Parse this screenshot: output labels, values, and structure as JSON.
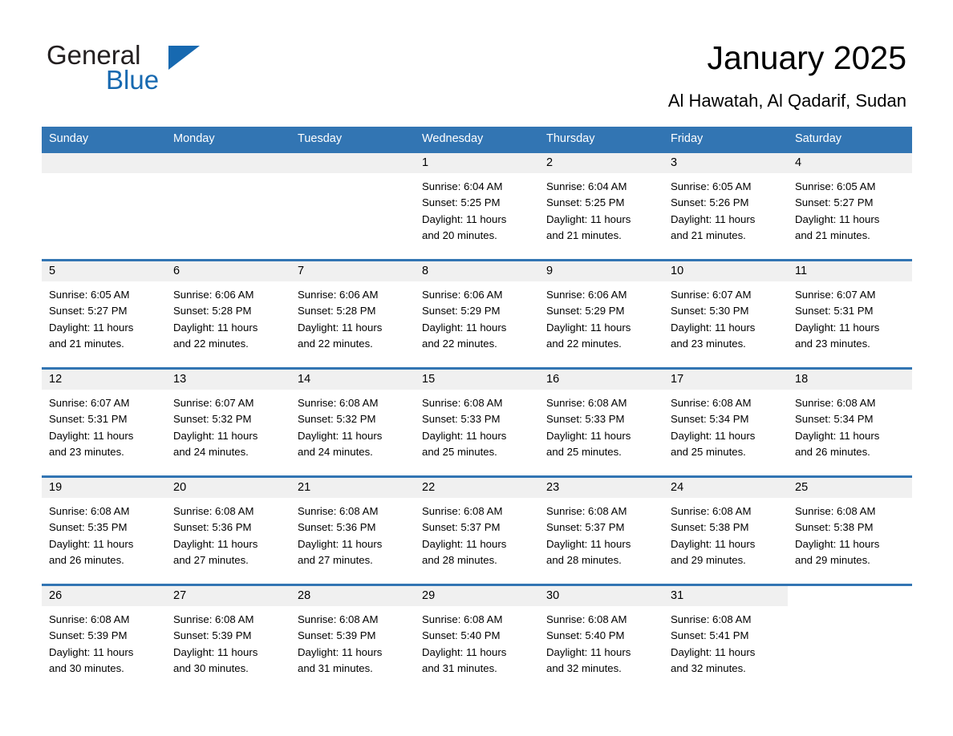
{
  "brand": {
    "name_part1": "General",
    "name_part2": "Blue",
    "accent_color": "#1769b0"
  },
  "header": {
    "title": "January 2025",
    "subtitle": "Al Hawatah, Al Qadarif, Sudan"
  },
  "calendar": {
    "header_bg": "#3275b3",
    "daynum_bg": "#f0f0f0",
    "weekday_names": [
      "Sunday",
      "Monday",
      "Tuesday",
      "Wednesday",
      "Thursday",
      "Friday",
      "Saturday"
    ],
    "weeks": [
      [
        {
          "day": "",
          "lines": []
        },
        {
          "day": "",
          "lines": []
        },
        {
          "day": "",
          "lines": []
        },
        {
          "day": "1",
          "lines": [
            "Sunrise: 6:04 AM",
            "Sunset: 5:25 PM",
            "Daylight: 11 hours",
            "and 20 minutes."
          ]
        },
        {
          "day": "2",
          "lines": [
            "Sunrise: 6:04 AM",
            "Sunset: 5:25 PM",
            "Daylight: 11 hours",
            "and 21 minutes."
          ]
        },
        {
          "day": "3",
          "lines": [
            "Sunrise: 6:05 AM",
            "Sunset: 5:26 PM",
            "Daylight: 11 hours",
            "and 21 minutes."
          ]
        },
        {
          "day": "4",
          "lines": [
            "Sunrise: 6:05 AM",
            "Sunset: 5:27 PM",
            "Daylight: 11 hours",
            "and 21 minutes."
          ]
        }
      ],
      [
        {
          "day": "5",
          "lines": [
            "Sunrise: 6:05 AM",
            "Sunset: 5:27 PM",
            "Daylight: 11 hours",
            "and 21 minutes."
          ]
        },
        {
          "day": "6",
          "lines": [
            "Sunrise: 6:06 AM",
            "Sunset: 5:28 PM",
            "Daylight: 11 hours",
            "and 22 minutes."
          ]
        },
        {
          "day": "7",
          "lines": [
            "Sunrise: 6:06 AM",
            "Sunset: 5:28 PM",
            "Daylight: 11 hours",
            "and 22 minutes."
          ]
        },
        {
          "day": "8",
          "lines": [
            "Sunrise: 6:06 AM",
            "Sunset: 5:29 PM",
            "Daylight: 11 hours",
            "and 22 minutes."
          ]
        },
        {
          "day": "9",
          "lines": [
            "Sunrise: 6:06 AM",
            "Sunset: 5:29 PM",
            "Daylight: 11 hours",
            "and 22 minutes."
          ]
        },
        {
          "day": "10",
          "lines": [
            "Sunrise: 6:07 AM",
            "Sunset: 5:30 PM",
            "Daylight: 11 hours",
            "and 23 minutes."
          ]
        },
        {
          "day": "11",
          "lines": [
            "Sunrise: 6:07 AM",
            "Sunset: 5:31 PM",
            "Daylight: 11 hours",
            "and 23 minutes."
          ]
        }
      ],
      [
        {
          "day": "12",
          "lines": [
            "Sunrise: 6:07 AM",
            "Sunset: 5:31 PM",
            "Daylight: 11 hours",
            "and 23 minutes."
          ]
        },
        {
          "day": "13",
          "lines": [
            "Sunrise: 6:07 AM",
            "Sunset: 5:32 PM",
            "Daylight: 11 hours",
            "and 24 minutes."
          ]
        },
        {
          "day": "14",
          "lines": [
            "Sunrise: 6:08 AM",
            "Sunset: 5:32 PM",
            "Daylight: 11 hours",
            "and 24 minutes."
          ]
        },
        {
          "day": "15",
          "lines": [
            "Sunrise: 6:08 AM",
            "Sunset: 5:33 PM",
            "Daylight: 11 hours",
            "and 25 minutes."
          ]
        },
        {
          "day": "16",
          "lines": [
            "Sunrise: 6:08 AM",
            "Sunset: 5:33 PM",
            "Daylight: 11 hours",
            "and 25 minutes."
          ]
        },
        {
          "day": "17",
          "lines": [
            "Sunrise: 6:08 AM",
            "Sunset: 5:34 PM",
            "Daylight: 11 hours",
            "and 25 minutes."
          ]
        },
        {
          "day": "18",
          "lines": [
            "Sunrise: 6:08 AM",
            "Sunset: 5:34 PM",
            "Daylight: 11 hours",
            "and 26 minutes."
          ]
        }
      ],
      [
        {
          "day": "19",
          "lines": [
            "Sunrise: 6:08 AM",
            "Sunset: 5:35 PM",
            "Daylight: 11 hours",
            "and 26 minutes."
          ]
        },
        {
          "day": "20",
          "lines": [
            "Sunrise: 6:08 AM",
            "Sunset: 5:36 PM",
            "Daylight: 11 hours",
            "and 27 minutes."
          ]
        },
        {
          "day": "21",
          "lines": [
            "Sunrise: 6:08 AM",
            "Sunset: 5:36 PM",
            "Daylight: 11 hours",
            "and 27 minutes."
          ]
        },
        {
          "day": "22",
          "lines": [
            "Sunrise: 6:08 AM",
            "Sunset: 5:37 PM",
            "Daylight: 11 hours",
            "and 28 minutes."
          ]
        },
        {
          "day": "23",
          "lines": [
            "Sunrise: 6:08 AM",
            "Sunset: 5:37 PM",
            "Daylight: 11 hours",
            "and 28 minutes."
          ]
        },
        {
          "day": "24",
          "lines": [
            "Sunrise: 6:08 AM",
            "Sunset: 5:38 PM",
            "Daylight: 11 hours",
            "and 29 minutes."
          ]
        },
        {
          "day": "25",
          "lines": [
            "Sunrise: 6:08 AM",
            "Sunset: 5:38 PM",
            "Daylight: 11 hours",
            "and 29 minutes."
          ]
        }
      ],
      [
        {
          "day": "26",
          "lines": [
            "Sunrise: 6:08 AM",
            "Sunset: 5:39 PM",
            "Daylight: 11 hours",
            "and 30 minutes."
          ]
        },
        {
          "day": "27",
          "lines": [
            "Sunrise: 6:08 AM",
            "Sunset: 5:39 PM",
            "Daylight: 11 hours",
            "and 30 minutes."
          ]
        },
        {
          "day": "28",
          "lines": [
            "Sunrise: 6:08 AM",
            "Sunset: 5:39 PM",
            "Daylight: 11 hours",
            "and 31 minutes."
          ]
        },
        {
          "day": "29",
          "lines": [
            "Sunrise: 6:08 AM",
            "Sunset: 5:40 PM",
            "Daylight: 11 hours",
            "and 31 minutes."
          ]
        },
        {
          "day": "30",
          "lines": [
            "Sunrise: 6:08 AM",
            "Sunset: 5:40 PM",
            "Daylight: 11 hours",
            "and 32 minutes."
          ]
        },
        {
          "day": "31",
          "lines": [
            "Sunrise: 6:08 AM",
            "Sunset: 5:41 PM",
            "Daylight: 11 hours",
            "and 32 minutes."
          ]
        },
        {
          "day": "",
          "lines": []
        }
      ]
    ]
  }
}
